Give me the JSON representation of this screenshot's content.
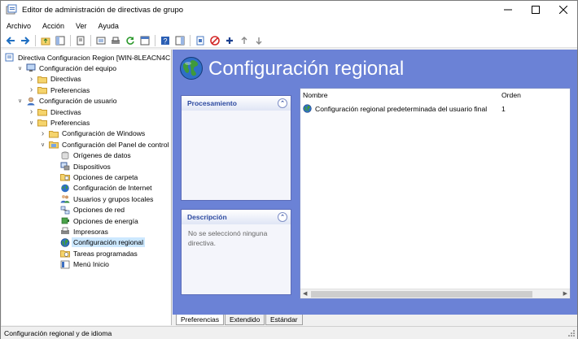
{
  "window": {
    "title": "Editor de administración de directivas de grupo",
    "controls": [
      "minimize",
      "maximize",
      "close"
    ]
  },
  "menu": [
    "Archivo",
    "Acción",
    "Ver",
    "Ayuda"
  ],
  "toolbar_icons": [
    "back-icon",
    "forward-icon",
    "up-folder-icon",
    "show-hide-tree-icon",
    "properties-icon",
    "export-list-icon",
    "print-icon",
    "refresh-icon",
    "new-window-icon",
    "help-icon",
    "show-pane-icon",
    "new-item-icon",
    "delete-icon",
    "add-icon",
    "move-up-icon",
    "move-down-icon"
  ],
  "tree": {
    "nodes": [
      {
        "label": "Directiva Configuracion Region [WIN-8LEACN4C",
        "depth": 0,
        "exp": "",
        "icon": "policy-icon"
      },
      {
        "label": "Configuración del equipo",
        "depth": 1,
        "exp": "open",
        "icon": "computer-icon"
      },
      {
        "label": "Directivas",
        "depth": 2,
        "exp": "closed",
        "icon": "folder-icon"
      },
      {
        "label": "Preferencias",
        "depth": 2,
        "exp": "closed",
        "icon": "folder-icon"
      },
      {
        "label": "Configuración de usuario",
        "depth": 1,
        "exp": "open",
        "icon": "user-icon"
      },
      {
        "label": "Directivas",
        "depth": 2,
        "exp": "closed",
        "icon": "folder-icon"
      },
      {
        "label": "Preferencias",
        "depth": 2,
        "exp": "open",
        "icon": "folder-icon"
      },
      {
        "label": "Configuración de Windows",
        "depth": 3,
        "exp": "closed",
        "icon": "folder-icon"
      },
      {
        "label": "Configuración del Panel de control",
        "depth": 3,
        "exp": "open",
        "icon": "control-panel-icon"
      },
      {
        "label": "Orígenes de datos",
        "depth": 4,
        "exp": "",
        "icon": "datasource-icon"
      },
      {
        "label": "Dispositivos",
        "depth": 4,
        "exp": "",
        "icon": "devices-icon"
      },
      {
        "label": "Opciones de carpeta",
        "depth": 4,
        "exp": "",
        "icon": "folder-options-icon"
      },
      {
        "label": "Configuración de Internet",
        "depth": 4,
        "exp": "",
        "icon": "internet-icon"
      },
      {
        "label": "Usuarios y grupos locales",
        "depth": 4,
        "exp": "",
        "icon": "users-groups-icon"
      },
      {
        "label": "Opciones de red",
        "depth": 4,
        "exp": "",
        "icon": "network-icon"
      },
      {
        "label": "Opciones de energía",
        "depth": 4,
        "exp": "",
        "icon": "power-icon"
      },
      {
        "label": "Impresoras",
        "depth": 4,
        "exp": "",
        "icon": "printer-icon"
      },
      {
        "label": "Configuración regional",
        "depth": 4,
        "exp": "",
        "icon": "globe-icon",
        "selected": true
      },
      {
        "label": "Tareas programadas",
        "depth": 4,
        "exp": "",
        "icon": "scheduled-tasks-icon"
      },
      {
        "label": "Menú Inicio",
        "depth": 4,
        "exp": "",
        "icon": "start-menu-icon"
      }
    ]
  },
  "main": {
    "heading": "Configuración regional",
    "processing_panel": {
      "title": "Procesamiento"
    },
    "description_panel": {
      "title": "Descripción",
      "text": "No se seleccionó ninguna directiva."
    },
    "list": {
      "columns": [
        "Nombre",
        "Orden"
      ],
      "rows": [
        {
          "name": "Configuración regional predeterminada del usuario final",
          "order": "1"
        }
      ]
    },
    "tabs": [
      "Preferencias",
      "Extendido",
      "Estándar"
    ],
    "active_tab": "Preferencias"
  },
  "status_text": "Configuración regional y de idioma",
  "colors": {
    "banner": "#6b82d6",
    "panel_heading": "#2d4aa0",
    "selection": "#cce8ff"
  }
}
